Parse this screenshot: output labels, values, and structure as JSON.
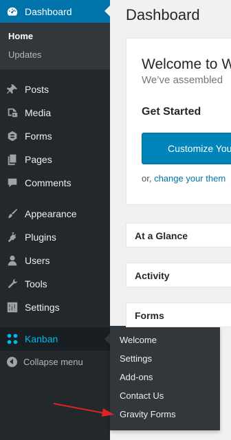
{
  "sidebar": {
    "dashboard_label": "Dashboard",
    "dashboard_sub": {
      "home": "Home",
      "updates": "Updates"
    },
    "items": [
      {
        "label": "Posts",
        "icon": "pin-icon"
      },
      {
        "label": "Media",
        "icon": "media-icon"
      },
      {
        "label": "Forms",
        "icon": "forms-icon"
      },
      {
        "label": "Pages",
        "icon": "pages-icon"
      },
      {
        "label": "Comments",
        "icon": "comment-icon"
      },
      {
        "label": "Appearance",
        "icon": "brush-icon"
      },
      {
        "label": "Plugins",
        "icon": "plug-icon"
      },
      {
        "label": "Users",
        "icon": "user-icon"
      },
      {
        "label": "Tools",
        "icon": "wrench-icon"
      },
      {
        "label": "Settings",
        "icon": "sliders-icon"
      }
    ],
    "kanban_label": "Kanban",
    "collapse_label": "Collapse menu"
  },
  "flyout": {
    "items": [
      "Welcome",
      "Settings",
      "Add-ons",
      "Contact Us",
      "Gravity Forms"
    ]
  },
  "content": {
    "page_title": "Dashboard",
    "welcome": {
      "title": "Welcome to W",
      "subtitle": "We’ve assembled",
      "get_started": "Get Started",
      "button": "Customize You",
      "or_prefix": "or, ",
      "or_link": "change your them"
    },
    "boxes": [
      "At a Glance",
      "Activity",
      "Forms"
    ]
  },
  "colors": {
    "sidebar_bg": "#23282d",
    "accent": "#0073aa",
    "kanban_label": "#00b9eb",
    "annotation_arrow": "#e02424"
  }
}
